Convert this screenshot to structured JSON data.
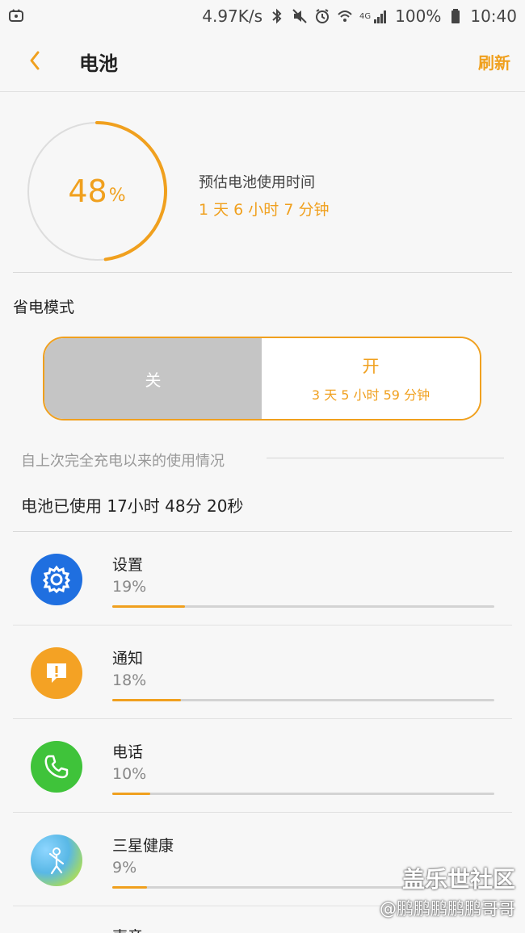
{
  "status_bar": {
    "left_icon": "tv-icon",
    "net_speed": "4.97K/s",
    "icons": [
      "bluetooth-icon",
      "mute-icon",
      "alarm-icon",
      "wifi-icon",
      "signal-icon"
    ],
    "network_label": "4G",
    "battery_percent": "100%",
    "battery_icon": "battery-full-icon",
    "time": "10:40"
  },
  "header": {
    "back_icon": "chevron-left-icon",
    "title": "电池",
    "refresh_label": "刷新"
  },
  "battery": {
    "percent": "48",
    "percent_value": 48,
    "percent_sign": "%",
    "estimate_label": "预估电池使用时间",
    "estimate_value": "1 天 6 小时 7 分钟"
  },
  "power_saving": {
    "title": "省电模式",
    "off_label": "关",
    "on_label": "开",
    "on_estimate": "3 天 5 小时 59 分钟"
  },
  "usage": {
    "section_title": "自上次完全充电以来的使用情况",
    "total_used": "电池已使用 17小时 48分 20秒"
  },
  "apps": [
    {
      "name": "设置",
      "percent": "19%",
      "value": 19,
      "icon": "gear-icon",
      "color": "#1f6fe0"
    },
    {
      "name": "通知",
      "percent": "18%",
      "value": 18,
      "icon": "notification-icon",
      "color": "#f4a224"
    },
    {
      "name": "电话",
      "percent": "10%",
      "value": 10,
      "icon": "phone-icon",
      "color": "#3fc33a"
    },
    {
      "name": "三星健康",
      "percent": "9%",
      "value": 9,
      "icon": "health-icon",
      "color": "#6fc7e8"
    }
  ],
  "partial_app": {
    "name": "声音"
  },
  "watermark": {
    "main": "盖乐世社区",
    "sub": "@鹏鹏鹏鹏鹏哥哥"
  },
  "colors": {
    "accent": "#f0a01e",
    "toggle_off": "#c5c5c5",
    "bar_track": "#d3d3d3"
  }
}
